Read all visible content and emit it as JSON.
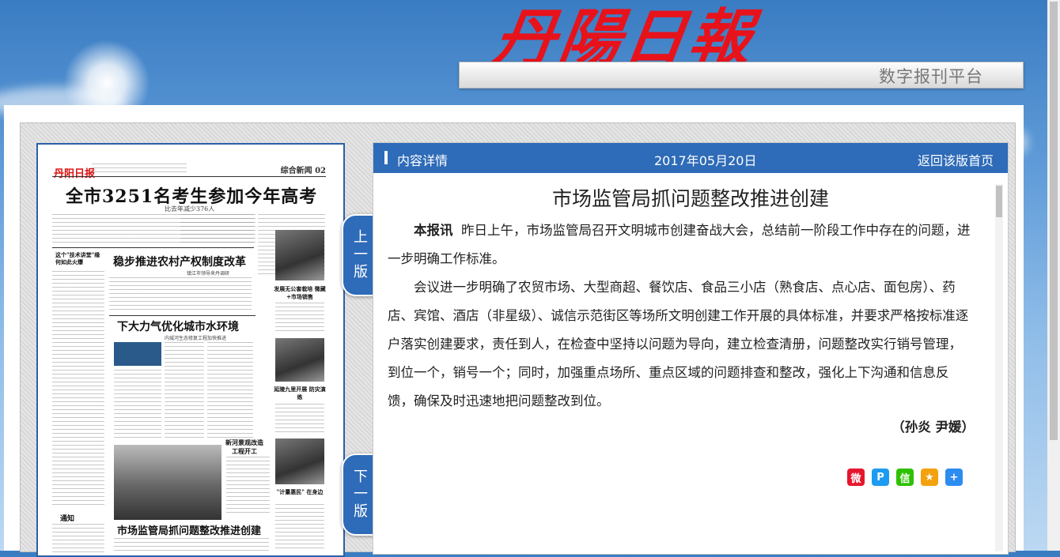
{
  "masthead": {
    "title": "丹陽日報",
    "platform": "数字报刊平台"
  },
  "newspaper": {
    "logo": "丹阳日报",
    "section": "综合新闻 02",
    "headline": "全市3251名考生参加今年高考",
    "subheadline": "比去年减少376人",
    "story2_title": "稳步推进农村产权制度改革",
    "story2_sub": "镇江市领导来丹调研",
    "story3_title": "下大力气优化城市水环境",
    "story3_sub": "内城河生态修复工程加快推进",
    "story4_title": "市场监管局抓问题整改推进创建",
    "tag": "这个\"技术讲堂\"缘何如此火爆",
    "note": "通知",
    "captions": [
      "发展无公害栽培 微藏+市场销售",
      "延陵九里开展 防灾演练",
      "新河景观改造 工程开工",
      "\"计量惠民\" 在身边"
    ]
  },
  "nav": {
    "prev": "上一版",
    "next": "下一版"
  },
  "content": {
    "header_label": "内容详情",
    "date": "2017年05月20日",
    "back_label": "返回该版首页",
    "title": "市场监管局抓问题整改推进创建",
    "lead_tag": "本报讯",
    "para1": "昨日上午，市场监管局召开文明城市创建奋战大会，总结前一阶段工作中存在的问题，进一步明确工作标准。",
    "para2": "会议进一步明确了农贸市场、大型商超、餐饮店、食品三小店（熟食店、点心店、面包房）、药店、宾馆、酒店（非星级）、诚信示范街区等场所文明创建工作开展的具体标准，并要求严格按标准逐户落实创建要求，责任到人，在检查中坚持以问题为导向，建立检查清册，问题整改实行销号管理，到位一个，销号一个；同时，加强重点场所、重点区域的问题排查和整改，强化上下沟通和信息反馈，确保及时迅速地把问题整改到位。",
    "byline": "（孙炎 尹媛）"
  },
  "share": [
    {
      "name": "weibo-icon",
      "color": "#e6162d",
      "glyph": "微"
    },
    {
      "name": "pinterest-icon",
      "color": "#1d9bf0",
      "glyph": "P"
    },
    {
      "name": "wechat-icon",
      "color": "#2dc100",
      "glyph": "信"
    },
    {
      "name": "favorite-star-icon",
      "color": "#f2a20c",
      "glyph": "★"
    },
    {
      "name": "more-plus-icon",
      "color": "#2d8cf0",
      "glyph": "+"
    }
  ]
}
